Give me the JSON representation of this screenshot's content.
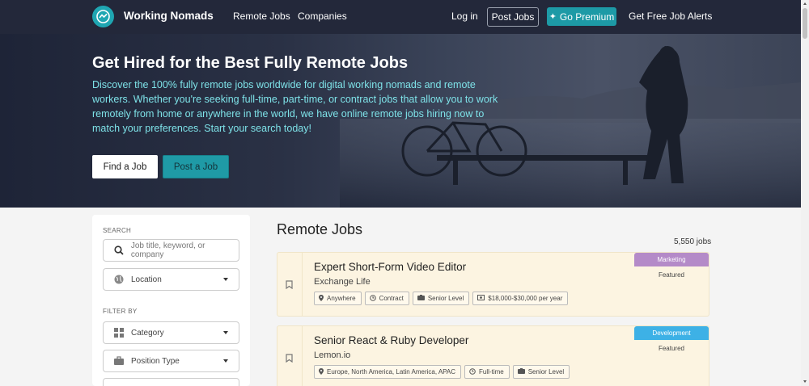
{
  "header": {
    "brand": "Working Nomads",
    "nav": [
      "Remote Jobs",
      "Companies"
    ],
    "login": "Log in",
    "post_jobs": "Post Jobs",
    "premium": "Go Premium",
    "alerts": "Get Free Job Alerts"
  },
  "hero": {
    "title": "Get Hired for the Best Fully Remote Jobs",
    "description": "Discover the 100% fully remote jobs worldwide for digital working nomads and remote workers. Whether you're seeking full-time, part-time, or contract jobs that allow you to work remotely from home or anywhere in the world, we have online remote jobs hiring now to match your preferences. Start your search today!",
    "find_button": "Find a Job",
    "post_button": "Post a Job"
  },
  "sidebar": {
    "search_label": "SEARCH",
    "search_placeholder": "Job title, keyword, or company",
    "location": "Location",
    "filter_label": "FILTER BY",
    "category": "Category",
    "position_type": "Position Type"
  },
  "main": {
    "title": "Remote Jobs",
    "count": "5,550 jobs",
    "jobs": [
      {
        "title": "Expert Short-Form Video Editor",
        "company": "Exchange Life",
        "badge": "Marketing",
        "badge_color": "#b48ac8",
        "featured": "Featured",
        "tags": [
          {
            "icon": "location-icon",
            "text": "Anywhere"
          },
          {
            "icon": "clock-icon",
            "text": "Contract"
          },
          {
            "icon": "level-icon",
            "text": "Senior Level"
          },
          {
            "icon": "money-icon",
            "text": "$18,000-$30,000 per year"
          }
        ]
      },
      {
        "title": "Senior React & Ruby Developer",
        "company": "Lemon.io",
        "badge": "Development",
        "badge_color": "#3db1e6",
        "featured": "Featured",
        "tags": [
          {
            "icon": "location-icon",
            "text": "Europe, North America, Latin America, APAC"
          },
          {
            "icon": "clock-icon",
            "text": "Full-time"
          },
          {
            "icon": "level-icon",
            "text": "Senior Level"
          }
        ]
      }
    ]
  }
}
